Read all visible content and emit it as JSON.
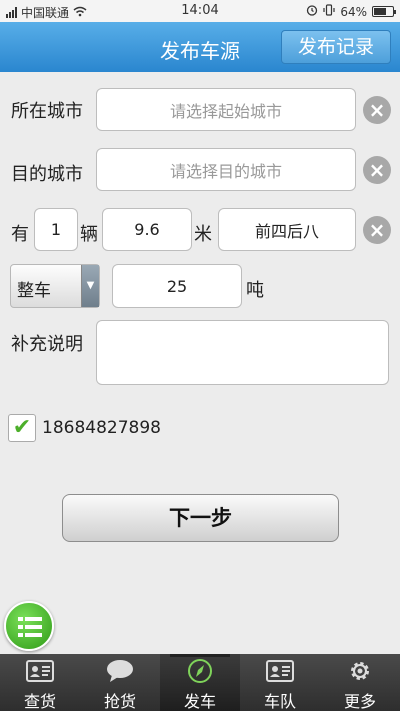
{
  "status_bar": {
    "carrier": "中国联通",
    "time": "14:04",
    "battery": "64%",
    "battery_level": 0.64
  },
  "header": {
    "title": "发布车源",
    "record_button": "发布记录"
  },
  "form": {
    "origin_label": "所在城市",
    "origin_placeholder": "请选择起始城市",
    "dest_label": "目的城市",
    "dest_placeholder": "请选择目的城市",
    "count_prefix": "有",
    "count_value": "1",
    "count_unit": "辆",
    "length_value": "9.6",
    "length_unit": "米",
    "vehicle_type": "前四后八",
    "load_mode": "整车",
    "weight_value": "25",
    "weight_unit": "吨",
    "notes_label": "补充说明",
    "notes_value": "",
    "phone": "18684827898",
    "phone_checked": true,
    "next_button": "下一步"
  },
  "tabbar": {
    "items": [
      {
        "label": "查货",
        "icon": "id-card-icon"
      },
      {
        "label": "抢货",
        "icon": "chat-bubble-icon"
      },
      {
        "label": "发车",
        "icon": "compass-icon",
        "active": true
      },
      {
        "label": "车队",
        "icon": "team-card-icon"
      },
      {
        "label": "更多",
        "icon": "gear-icon"
      }
    ]
  },
  "colors": {
    "header_blue": "#2a86cf",
    "check_green": "#4caf2a",
    "fab_green": "#2e9a16"
  }
}
